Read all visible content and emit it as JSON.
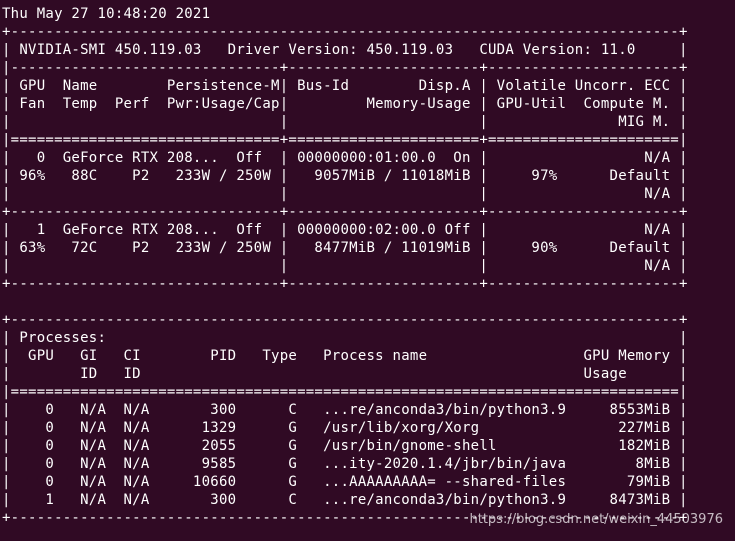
{
  "colors": {
    "background": "#300a24",
    "foreground": "#ffffff"
  },
  "terminal": {
    "lines": [
      "Thu May 27 10:48:20 2021",
      "+-----------------------------------------------------------------------------+",
      "| NVIDIA-SMI 450.119.03   Driver Version: 450.119.03   CUDA Version: 11.0     |",
      "|-------------------------------+----------------------+----------------------+",
      "| GPU  Name        Persistence-M| Bus-Id        Disp.A | Volatile Uncorr. ECC |",
      "| Fan  Temp  Perf  Pwr:Usage/Cap|         Memory-Usage | GPU-Util  Compute M. |",
      "|                               |                      |               MIG M. |",
      "|===============================+======================+======================|",
      "|   0  GeForce RTX 208...  Off  | 00000000:01:00.0  On |                  N/A |",
      "| 96%   88C    P2   233W / 250W |   9057MiB / 11018MiB |     97%      Default |",
      "|                               |                      |                  N/A |",
      "+-------------------------------+----------------------+----------------------+",
      "|   1  GeForce RTX 208...  Off  | 00000000:02:00.0 Off |                  N/A |",
      "| 63%   72C    P2   233W / 250W |   8477MiB / 11019MiB |     90%      Default |",
      "|                               |                      |                  N/A |",
      "+-------------------------------+----------------------+----------------------+",
      "",
      "+-----------------------------------------------------------------------------+",
      "| Processes:                                                                  |",
      "|  GPU   GI   CI        PID   Type   Process name                  GPU Memory |",
      "|        ID   ID                                                   Usage      |",
      "|=============================================================================|",
      "|    0   N/A  N/A       300      C   ...re/anconda3/bin/python3.9     8553MiB |",
      "|    0   N/A  N/A      1329      G   /usr/lib/xorg/Xorg                227MiB |",
      "|    0   N/A  N/A      2055      G   /usr/bin/gnome-shell              182MiB |",
      "|    0   N/A  N/A      9585      G   ...ity-2020.1.4/jbr/bin/java        8MiB |",
      "|    0   N/A  N/A     10660      G   ...AAAAAAAAA= --shared-files       79MiB |",
      "|    1   N/A  N/A       300      C   ...re/anconda3/bin/python3.9     8473MiB |",
      "+-----------------------------------------------------------------------------+"
    ]
  },
  "watermark": "https://blog.csdn.net/weixin_44503976"
}
